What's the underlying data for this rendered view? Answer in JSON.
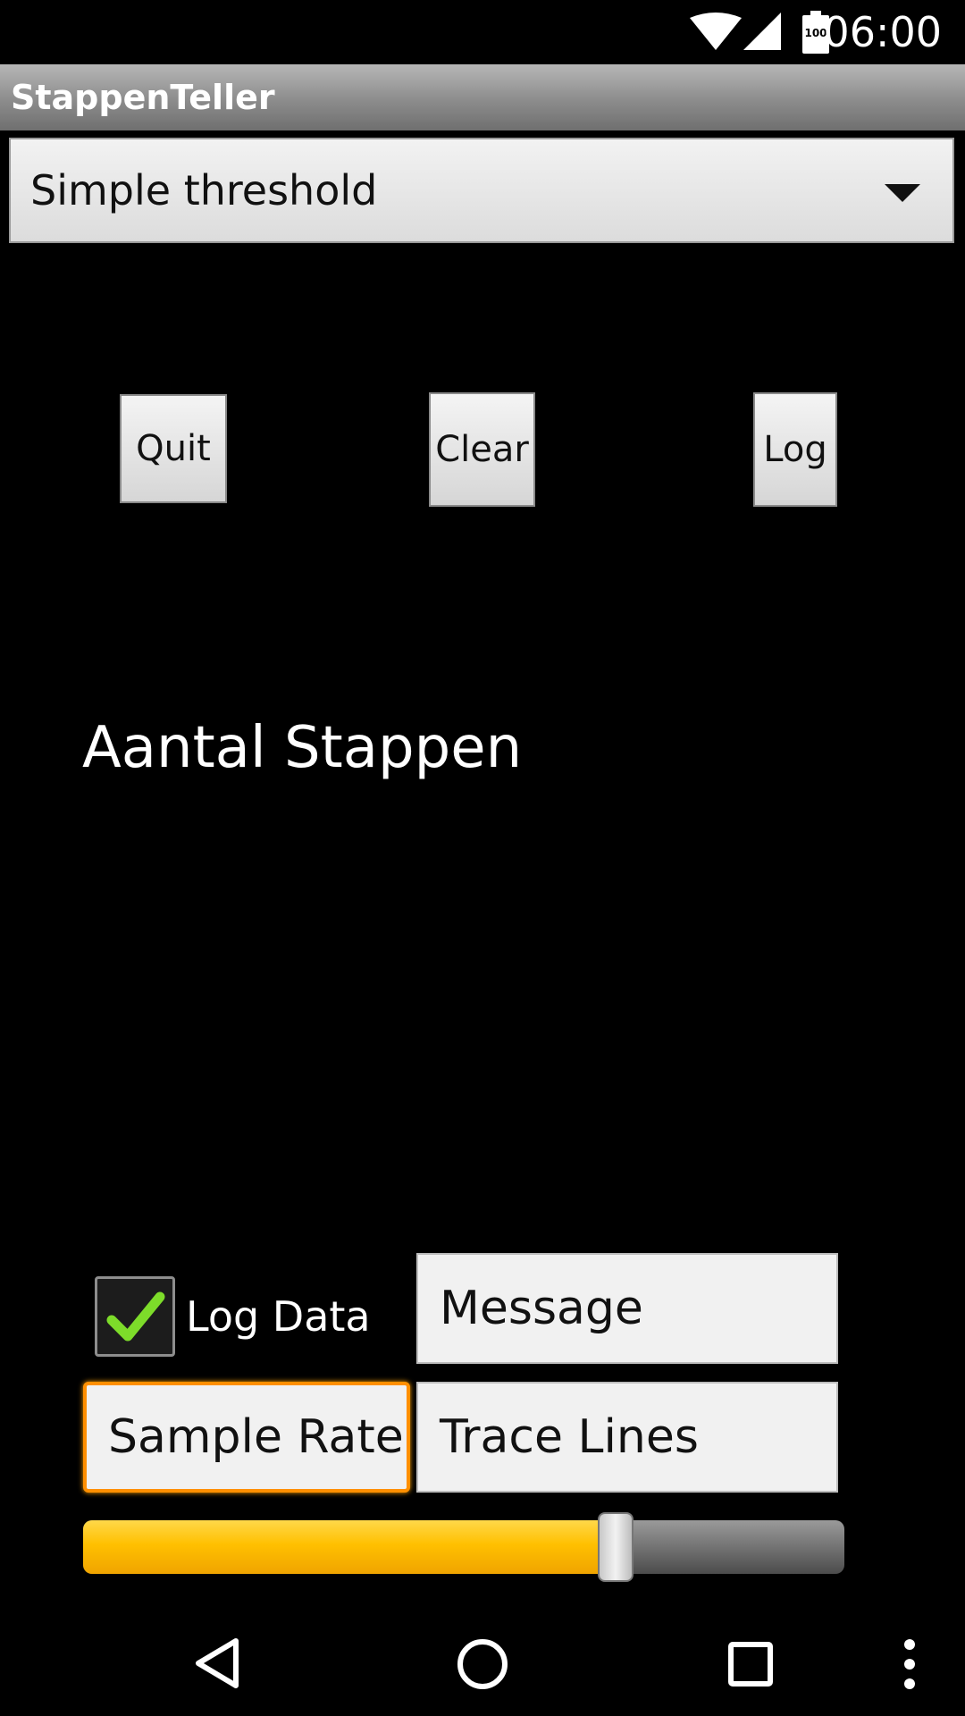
{
  "status_bar": {
    "time": "06:00",
    "battery_level": "100",
    "icons": [
      "wifi-icon",
      "signal-icon",
      "battery-icon"
    ]
  },
  "app": {
    "title": "StappenTeller"
  },
  "spinner": {
    "selected": "Simple threshold",
    "icon": "chevron-down-icon"
  },
  "buttons": {
    "quit": "Quit",
    "clear": "Clear",
    "log": "Log"
  },
  "main": {
    "step_count_label": "Aantal Stappen"
  },
  "controls": {
    "log_data_label": "Log Data",
    "log_data_checked": true,
    "message": "Message",
    "sample_rate": "Sample Rate",
    "trace_lines": "Trace Lines",
    "slider_fraction": 0.7
  },
  "colors": {
    "accent": "#ff8f00",
    "slider_fill": "#ffc000",
    "check": "#7ddc2a"
  },
  "nav_bar": {
    "icons": [
      "back-icon",
      "home-icon",
      "recents-icon",
      "overflow-menu-icon"
    ]
  }
}
